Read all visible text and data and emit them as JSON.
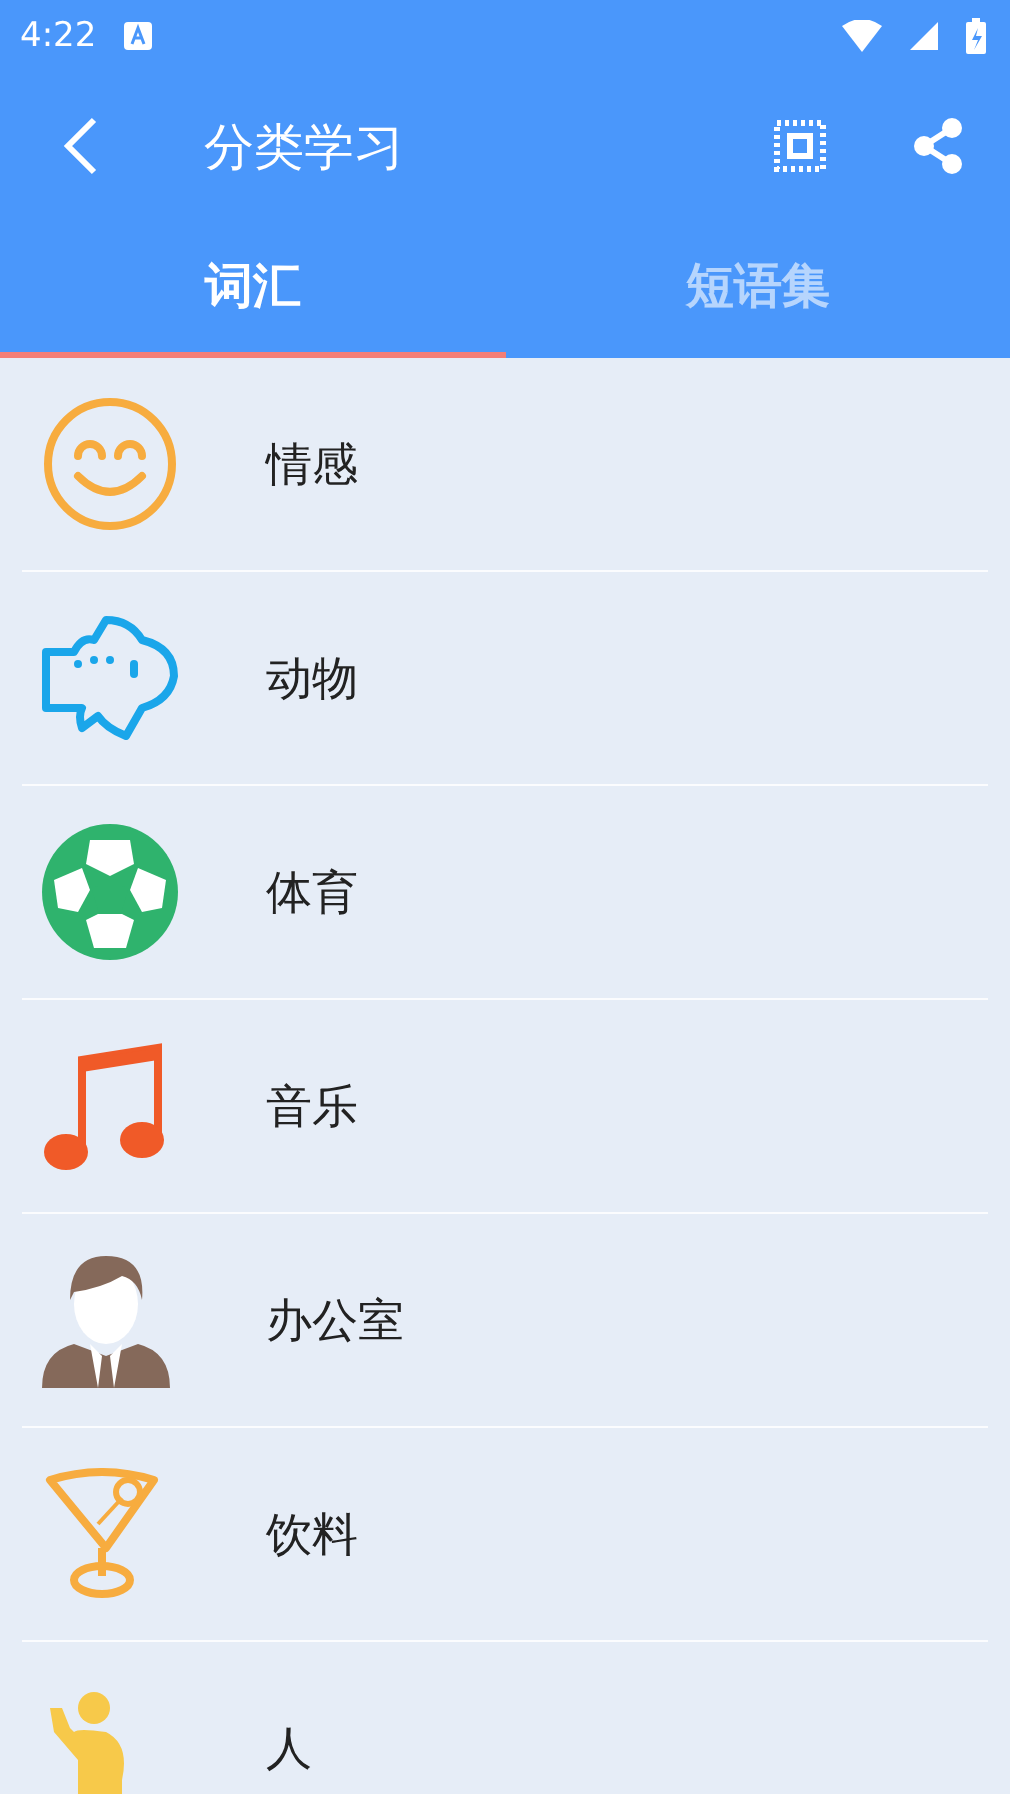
{
  "status_bar": {
    "time": "4:22"
  },
  "toolbar": {
    "title": "分类学习"
  },
  "tabs": [
    {
      "label": "词汇",
      "selected": true
    },
    {
      "label": "短语集",
      "selected": false
    }
  ],
  "categories": [
    {
      "label": "情感"
    },
    {
      "label": "动物"
    },
    {
      "label": "体育"
    },
    {
      "label": "音乐"
    },
    {
      "label": "办公室"
    },
    {
      "label": "饮料"
    },
    {
      "label": "人"
    }
  ]
}
